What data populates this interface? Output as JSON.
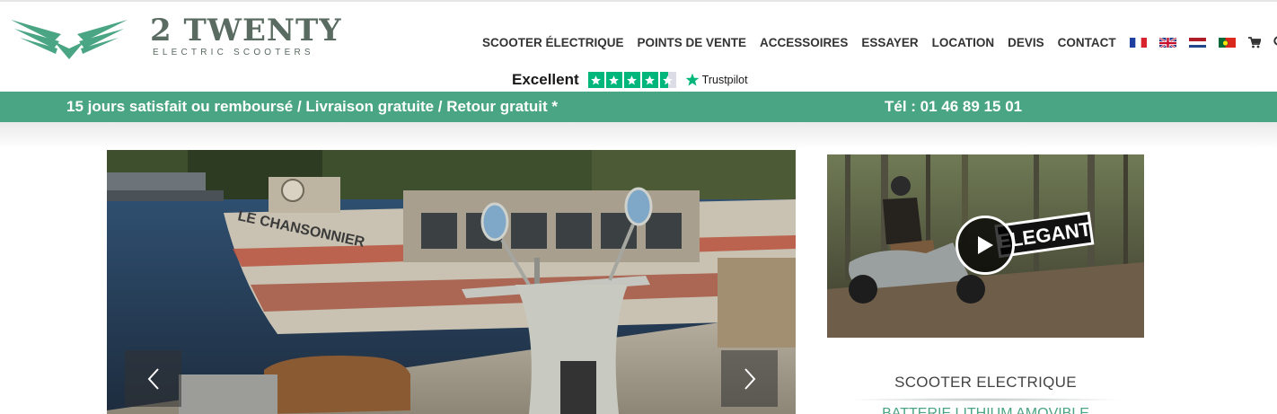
{
  "brand": {
    "name": "2 TWENTY",
    "tagline": "ELECTRIC SCOOTERS",
    "color": "#4aa584",
    "text_color": "#5a6b61"
  },
  "nav": {
    "items": [
      {
        "label": "SCOOTER ÉLECTRIQUE"
      },
      {
        "label": "POINTS DE VENTE"
      },
      {
        "label": "ACCESSOIRES"
      },
      {
        "label": "ESSAYER"
      },
      {
        "label": "LOCATION"
      },
      {
        "label": "DEVIS"
      },
      {
        "label": "CONTACT"
      }
    ],
    "flags": [
      "fr-flag-icon",
      "uk-flag-icon",
      "nl-flag-icon",
      "pt-flag-icon"
    ],
    "icons": [
      "cart-icon",
      "search-icon"
    ]
  },
  "trustpilot": {
    "rating_word": "Excellent",
    "stars": 4.5,
    "brand": "Trustpilot",
    "star_color": "#00b67a"
  },
  "banner": {
    "left_text": "15 jours satisfait ou remboursé / Livraison gratuite / Retour gratuit *",
    "right_text": "Tél : 01 46 89 15 01"
  },
  "slider": {
    "boat_name": "LE CHANSONNIER",
    "prev_icon": "chevron-left-icon",
    "next_icon": "chevron-right-icon"
  },
  "video": {
    "overlay_text": "ELEGANT",
    "play_icon": "play-icon"
  },
  "sidebar": {
    "title": "SCOOTER ELECTRIQUE",
    "subtitle": "BATTERIE LITHIUM AMOVIBLE"
  }
}
